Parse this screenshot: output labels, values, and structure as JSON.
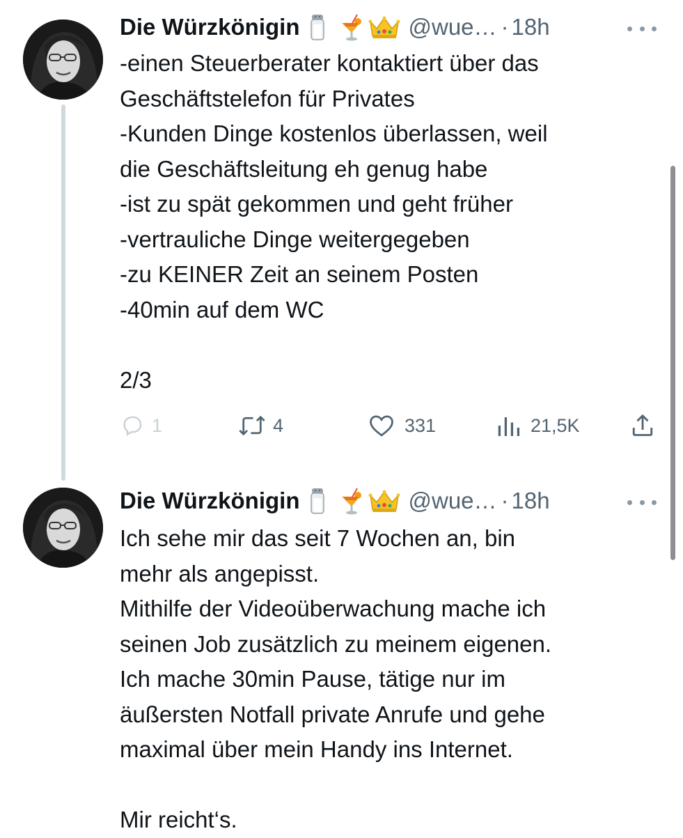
{
  "tweets": [
    {
      "author": {
        "display_name": "Die Würzkönigin",
        "emoji": [
          "salt-shaker",
          "tropical-drink",
          "crown"
        ],
        "handle": "@wue…",
        "separator": "·",
        "time": "18h"
      },
      "text": "-einen Steuerberater kontaktiert über das\nGeschäftstelefon für Privates\n-Kunden Dinge kostenlos überlassen, weil\ndie Geschäftsleitung eh genug habe\n-ist zu spät gekommen und geht früher\n-vertrauliche Dinge weitergegeben\n-zu KEINER Zeit an seinem Posten\n-40min auf dem WC\n\n2/3",
      "stats": {
        "replies": "1",
        "retweets": "4",
        "likes": "331",
        "views": "21,5K"
      }
    },
    {
      "author": {
        "display_name": "Die Würzkönigin",
        "emoji": [
          "salt-shaker",
          "tropical-drink",
          "crown"
        ],
        "handle": "@wue…",
        "separator": "·",
        "time": "18h"
      },
      "text": "Ich sehe mir das seit 7 Wochen an, bin\nmehr als angepisst.\nMithilfe der Videoüberwachung mache ich\nseinen Job zusätzlich zu meinem eigenen.\nIch mache 30min Pause, tätige nur im\näußersten Notfall private Anrufe und gehe\nmaximal über mein Handy ins Internet.\n\nMir reicht‘s."
    }
  ],
  "icons": {
    "reply": "reply-icon",
    "retweet": "retweet-icon",
    "like": "heart-icon",
    "views": "views-icon",
    "share": "share-icon",
    "more": "more-icon"
  },
  "colors": {
    "text": "#0f1419",
    "muted": "#536471",
    "thread_line": "#cfd9de",
    "reply_disabled": "#c9d1d6"
  }
}
